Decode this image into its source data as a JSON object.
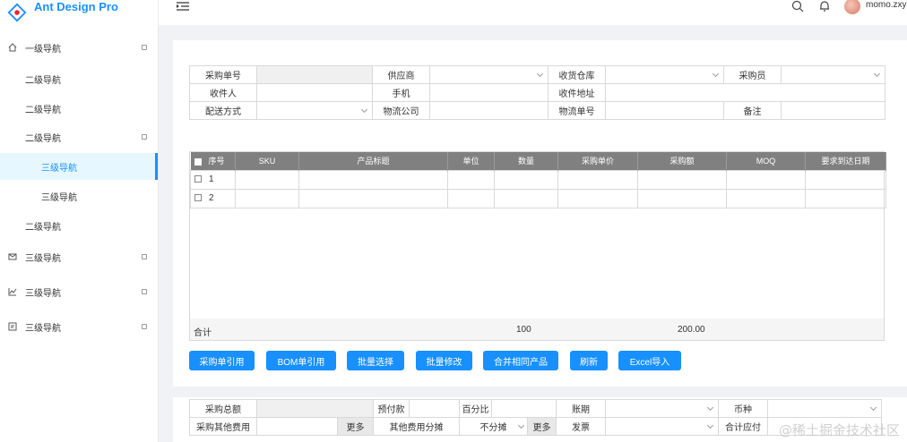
{
  "app": {
    "title": "Ant Design Pro"
  },
  "sidebar": {
    "items": [
      {
        "label": "一级导航",
        "icon": "home-icon"
      },
      {
        "label": "二级导航"
      },
      {
        "label": "二级导航"
      },
      {
        "label": "二级导航"
      },
      {
        "label": "三级导航"
      },
      {
        "label": "三级导航"
      },
      {
        "label": "二级导航"
      },
      {
        "label": "三级导航",
        "icon": "mail-icon"
      },
      {
        "label": "三级导航",
        "icon": "chart-icon"
      },
      {
        "label": "三级导航",
        "icon": "form-icon"
      }
    ]
  },
  "header": {
    "username": "momo.zxy"
  },
  "form": {
    "purchase_no_label": "采购单号",
    "supplier_label": "供应商",
    "warehouse_label": "收货仓库",
    "buyer_label": "采购员",
    "receiver_label": "收件人",
    "phone_label": "手机",
    "address_label": "收件地址",
    "delivery_label": "配送方式",
    "logistics_label": "物流公司",
    "tracking_label": "物流单号",
    "remark_label": "备注"
  },
  "items": {
    "headers": [
      "序号",
      "SKU",
      "产品标题",
      "单位",
      "数量",
      "采购单价",
      "采购额",
      "MOQ",
      "要求到达日期"
    ],
    "rows": [
      {
        "no": "1"
      },
      {
        "no": "2"
      }
    ],
    "total_label": "合计",
    "total_qty": "100",
    "total_amount": "200.00"
  },
  "buttons": [
    "采购单引用",
    "BOM单引用",
    "批量选择",
    "批量修改",
    "合并相同产品",
    "刷新",
    "Excel导入"
  ],
  "footer": {
    "total_label": "采购总额",
    "prepay_label": "预付款",
    "percent_label": "百分比",
    "period_label": "账期",
    "currency_label": "币种",
    "other_fee_label": "采购其他费用",
    "more1": "更多",
    "share_label": "其他费用分摊",
    "share_value": "不分摊",
    "more2": "更多",
    "invoice_label": "发票",
    "payable_label": "合计应付"
  },
  "watermark": "@稀土掘金技术社区",
  "colors": {
    "primary": "#1890ff",
    "header_gray": "#808080"
  }
}
